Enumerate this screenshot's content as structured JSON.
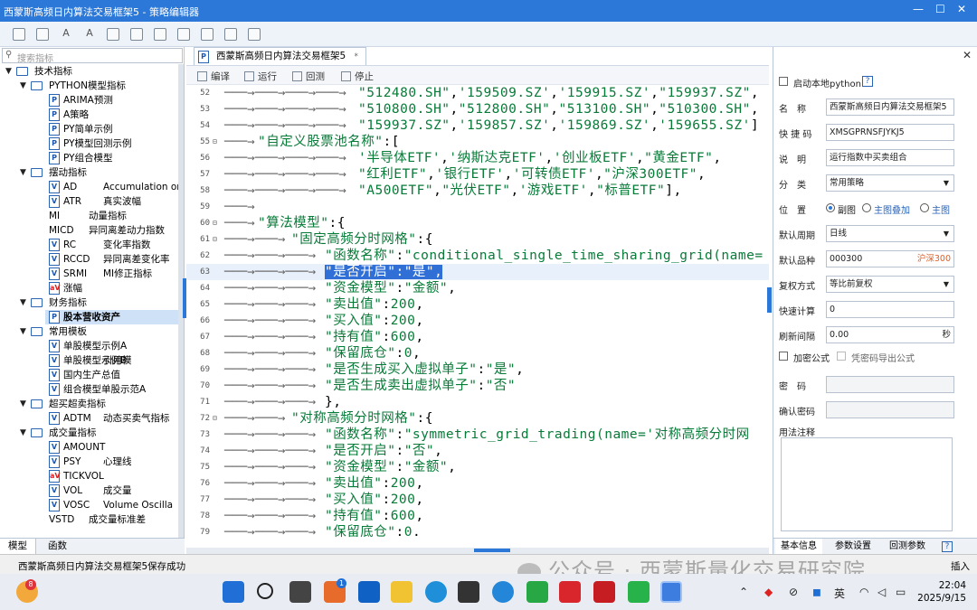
{
  "window": {
    "title": "西蒙斯高频日内算法交易框架5 - 策略编辑器"
  },
  "toolbar": {
    "icons": [
      "save-icon",
      "save-all-icon",
      "font-decrease-icon",
      "font-increase-icon",
      "import-icon",
      "export-icon",
      "copy-icon",
      "paste-icon",
      "doc-icon",
      "settings-icon",
      "doc-settings-icon"
    ]
  },
  "left": {
    "search_placeholder": "搜索指标",
    "tree": [
      {
        "level": 0,
        "kind": "folder",
        "expanded": true,
        "label": "技术指标"
      },
      {
        "level": 1,
        "kind": "folder",
        "expanded": true,
        "label": "PYTHON模型指标"
      },
      {
        "level": 2,
        "kind": "py",
        "label": "ARIMA预测"
      },
      {
        "level": 2,
        "kind": "py",
        "label": "A策略"
      },
      {
        "level": 2,
        "kind": "py",
        "label": "PY简单示例"
      },
      {
        "level": 2,
        "kind": "py",
        "label": "PY模型回测示例"
      },
      {
        "level": 2,
        "kind": "py",
        "label": "PY组合模型"
      },
      {
        "level": 1,
        "kind": "folder",
        "expanded": true,
        "label": "摆动指标"
      },
      {
        "level": 2,
        "kind": "v",
        "label": "AD",
        "desc": "Accumulation or"
      },
      {
        "level": 2,
        "kind": "v",
        "label": "ATR",
        "desc": "真实波幅"
      },
      {
        "level": 2,
        "kind": "none",
        "label": "MI",
        "desc": "动量指标"
      },
      {
        "level": 2,
        "kind": "none",
        "label": "MICD",
        "desc": "异同离差动力指数"
      },
      {
        "level": 2,
        "kind": "v",
        "label": "RC",
        "desc": "变化率指数"
      },
      {
        "level": 2,
        "kind": "v",
        "label": "RCCD",
        "desc": "异同离差变化率"
      },
      {
        "level": 2,
        "kind": "v",
        "label": "SRMI",
        "desc": "MI修正指标"
      },
      {
        "level": 2,
        "kind": "av",
        "label": "涨幅"
      },
      {
        "level": 1,
        "kind": "folder",
        "expanded": true,
        "label": "财务指标"
      },
      {
        "level": 2,
        "kind": "py",
        "label": "股本营收资产",
        "selected": true
      },
      {
        "level": 1,
        "kind": "folder",
        "expanded": true,
        "label": "常用模板"
      },
      {
        "level": 2,
        "kind": "v",
        "label": "单股模型示例A"
      },
      {
        "level": 2,
        "kind": "v",
        "label": "单股模型示例B",
        "desc": "引用模"
      },
      {
        "level": 2,
        "kind": "v",
        "label": "国内生产总值"
      },
      {
        "level": 2,
        "kind": "v",
        "label": "组合模型单股示范A"
      },
      {
        "level": 1,
        "kind": "folder",
        "expanded": true,
        "label": "超买超卖指标"
      },
      {
        "level": 2,
        "kind": "v",
        "label": "ADTM",
        "desc": "动态买卖气指标"
      },
      {
        "level": 1,
        "kind": "folder",
        "expanded": true,
        "label": "成交量指标"
      },
      {
        "level": 2,
        "kind": "v",
        "label": "AMOUNT"
      },
      {
        "level": 2,
        "kind": "v",
        "label": "PSY",
        "desc": "心理线"
      },
      {
        "level": 2,
        "kind": "av",
        "label": "TICKVOL"
      },
      {
        "level": 2,
        "kind": "v",
        "label": "VOL",
        "desc": "成交量"
      },
      {
        "level": 2,
        "kind": "v",
        "label": "VOSC",
        "desc": "Volume Oscilla"
      },
      {
        "level": 2,
        "kind": "none",
        "label": "VSTD",
        "desc": "成交量标准差"
      }
    ],
    "tabs": [
      "模型",
      "函数"
    ]
  },
  "editor": {
    "tab_label": "西蒙斯高频日内算法交易框架5",
    "tab_marker": "*",
    "buttons": {
      "compile": "编译",
      "run": "运行",
      "backtest": "回测",
      "stop": "停止"
    },
    "lines": [
      {
        "n": "52",
        "indent": 4,
        "fold": "",
        "segs": [
          [
            "s",
            "\"512480.SH\""
          ],
          [
            "k",
            ","
          ],
          [
            "s",
            "'159509.SZ'"
          ],
          [
            "k",
            ","
          ],
          [
            "s",
            "'159915.SZ'"
          ],
          [
            "k",
            ","
          ],
          [
            "s",
            "\"159937.SZ\""
          ],
          [
            "k",
            ","
          ]
        ]
      },
      {
        "n": "53",
        "indent": 4,
        "fold": "",
        "segs": [
          [
            "s",
            "\"510800.SH\""
          ],
          [
            "k",
            ","
          ],
          [
            "s",
            "\"512800.SH\""
          ],
          [
            "k",
            ","
          ],
          [
            "s",
            "\"513100.SH\""
          ],
          [
            "k",
            ","
          ],
          [
            "s",
            "\"510300.SH\""
          ],
          [
            "k",
            ","
          ]
        ]
      },
      {
        "n": "54",
        "indent": 4,
        "fold": "",
        "segs": [
          [
            "s",
            "\"159937.SZ\""
          ],
          [
            "k",
            ","
          ],
          [
            "s",
            "'159857.SZ'"
          ],
          [
            "k",
            ","
          ],
          [
            "s",
            "'159869.SZ'"
          ],
          [
            "k",
            ","
          ],
          [
            "s",
            "'159655.SZ'"
          ],
          [
            "k",
            "]"
          ]
        ]
      },
      {
        "n": "55",
        "indent": 1,
        "fold": "⊟",
        "segs": [
          [
            "s",
            "\"自定义股票池名称\""
          ],
          [
            "k",
            ":["
          ]
        ]
      },
      {
        "n": "56",
        "indent": 4,
        "fold": "",
        "segs": [
          [
            "s",
            "'半导体ETF'"
          ],
          [
            "k",
            ","
          ],
          [
            "s",
            "'纳斯达克ETF'"
          ],
          [
            "k",
            ","
          ],
          [
            "s",
            "'创业板ETF'"
          ],
          [
            "k",
            ","
          ],
          [
            "s",
            "\"黄金ETF\""
          ],
          [
            "k",
            ","
          ]
        ]
      },
      {
        "n": "57",
        "indent": 4,
        "fold": "",
        "segs": [
          [
            "s",
            "\"红利ETF\""
          ],
          [
            "k",
            ","
          ],
          [
            "s",
            "'银行ETF'"
          ],
          [
            "k",
            ","
          ],
          [
            "s",
            "'可转债ETF'"
          ],
          [
            "k",
            ","
          ],
          [
            "s",
            "\"沪深300ETF\""
          ],
          [
            "k",
            ","
          ]
        ]
      },
      {
        "n": "58",
        "indent": 4,
        "fold": "",
        "segs": [
          [
            "s",
            "\"A500ETF\""
          ],
          [
            "k",
            ","
          ],
          [
            "s",
            "\"光伏ETF\""
          ],
          [
            "k",
            ","
          ],
          [
            "s",
            "'游戏ETF'"
          ],
          [
            "k",
            ","
          ],
          [
            "s",
            "\"标普ETF\""
          ],
          [
            "k",
            "],"
          ]
        ]
      },
      {
        "n": "59",
        "indent": 1,
        "fold": "",
        "segs": []
      },
      {
        "n": "60",
        "indent": 1,
        "fold": "⊟",
        "segs": [
          [
            "s",
            "\"算法模型\""
          ],
          [
            "k",
            ":{"
          ]
        ]
      },
      {
        "n": "61",
        "indent": 2,
        "fold": "⊟",
        "segs": [
          [
            "s",
            "\"固定高频分时网格\""
          ],
          [
            "k",
            ":{"
          ]
        ]
      },
      {
        "n": "62",
        "indent": 3,
        "fold": "",
        "segs": [
          [
            "s",
            "\"函数名称\""
          ],
          [
            "k",
            ":"
          ],
          [
            "s",
            "\"conditional_single_time_sharing_grid(name="
          ]
        ]
      },
      {
        "n": "63",
        "indent": 3,
        "fold": "",
        "hl": true,
        "segs": [
          [
            "sel",
            "\"是否开启\":\"是\","
          ]
        ]
      },
      {
        "n": "64",
        "indent": 3,
        "fold": "",
        "segs": [
          [
            "s",
            "\"资金模型\""
          ],
          [
            "k",
            ":"
          ],
          [
            "s",
            "\"金额\""
          ],
          [
            "k",
            ","
          ]
        ]
      },
      {
        "n": "65",
        "indent": 3,
        "fold": "",
        "segs": [
          [
            "s",
            "\"卖出值\""
          ],
          [
            "k",
            ":"
          ],
          [
            "s",
            "200"
          ],
          [
            "k",
            ","
          ]
        ]
      },
      {
        "n": "66",
        "indent": 3,
        "fold": "",
        "segs": [
          [
            "s",
            "\"买入值\""
          ],
          [
            "k",
            ":"
          ],
          [
            "s",
            "200"
          ],
          [
            "k",
            ","
          ]
        ]
      },
      {
        "n": "67",
        "indent": 3,
        "fold": "",
        "segs": [
          [
            "s",
            "\"持有值\""
          ],
          [
            "k",
            ":"
          ],
          [
            "s",
            "600"
          ],
          [
            "k",
            ","
          ]
        ]
      },
      {
        "n": "68",
        "indent": 3,
        "fold": "",
        "segs": [
          [
            "s",
            "\"保留底仓\""
          ],
          [
            "k",
            ":"
          ],
          [
            "s",
            "0"
          ],
          [
            "k",
            ","
          ]
        ]
      },
      {
        "n": "69",
        "indent": 3,
        "fold": "",
        "segs": [
          [
            "s",
            "\"是否生成买入虚拟单子\""
          ],
          [
            "k",
            ":"
          ],
          [
            "s",
            "\"是\""
          ],
          [
            "k",
            ","
          ]
        ]
      },
      {
        "n": "70",
        "indent": 3,
        "fold": "",
        "segs": [
          [
            "s",
            "\"是否生成卖出虚拟单子\""
          ],
          [
            "k",
            ":"
          ],
          [
            "s",
            "\"否\""
          ]
        ]
      },
      {
        "n": "71",
        "indent": 3,
        "fold": "",
        "segs": [
          [
            "k",
            "},"
          ]
        ]
      },
      {
        "n": "72",
        "indent": 2,
        "fold": "⊟",
        "segs": [
          [
            "s",
            "\"对称高频分时网格\""
          ],
          [
            "k",
            ":{"
          ]
        ]
      },
      {
        "n": "73",
        "indent": 3,
        "fold": "",
        "segs": [
          [
            "s",
            "\"函数名称\""
          ],
          [
            "k",
            ":"
          ],
          [
            "s",
            "\"symmetric_grid_trading(name='对称高频分时网"
          ]
        ]
      },
      {
        "n": "74",
        "indent": 3,
        "fold": "",
        "segs": [
          [
            "s",
            "\"是否开启\""
          ],
          [
            "k",
            ":"
          ],
          [
            "s",
            "\"否\""
          ],
          [
            "k",
            ","
          ]
        ]
      },
      {
        "n": "75",
        "indent": 3,
        "fold": "",
        "segs": [
          [
            "s",
            "\"资金模型\""
          ],
          [
            "k",
            ":"
          ],
          [
            "s",
            "\"金额\""
          ],
          [
            "k",
            ","
          ]
        ]
      },
      {
        "n": "76",
        "indent": 3,
        "fold": "",
        "segs": [
          [
            "s",
            "\"卖出值\""
          ],
          [
            "k",
            ":"
          ],
          [
            "s",
            "200"
          ],
          [
            "k",
            ","
          ]
        ]
      },
      {
        "n": "77",
        "indent": 3,
        "fold": "",
        "segs": [
          [
            "s",
            "\"买入值\""
          ],
          [
            "k",
            ":"
          ],
          [
            "s",
            "200"
          ],
          [
            "k",
            ","
          ]
        ]
      },
      {
        "n": "78",
        "indent": 3,
        "fold": "",
        "segs": [
          [
            "s",
            "\"持有值\""
          ],
          [
            "k",
            ":"
          ],
          [
            "s",
            "600"
          ],
          [
            "k",
            ","
          ]
        ]
      },
      {
        "n": "79",
        "indent": 3,
        "fold": "",
        "segs": [
          [
            "s",
            "\"保留底仓\""
          ],
          [
            "k",
            ":"
          ],
          [
            "s",
            "0"
          ],
          [
            "k",
            "."
          ]
        ]
      }
    ]
  },
  "props": {
    "enable_local_python": "启动本地python",
    "name_label": "名　称",
    "name_value": "西蒙斯高频日内算法交易框架5",
    "code_label": "快 捷 码",
    "code_value": "XMSGPRNSFJYKJ5",
    "desc_label": "说　明",
    "desc_value": "运行指数中买卖组合",
    "cat_label": "分　类",
    "cat_value": "常用策略",
    "pos_label": "位　置",
    "pos_opts": [
      "副图",
      "主图叠加",
      "主图"
    ],
    "period_label": "默认周期",
    "period_value": "日线",
    "symbol_label": "默认品种",
    "symbol_value": "000300",
    "symbol_name": "沪深300",
    "adjust_label": "复权方式",
    "adjust_value": "等比前复权",
    "quick_label": "快速计算",
    "quick_value": "0",
    "refresh_label": "刷新间隔",
    "refresh_value": "0.00",
    "refresh_unit": "秒",
    "encrypt_label": "加密公式",
    "encrypt_export": "凭密码导出公式",
    "pwd_label": "密　码",
    "confirm_label": "确认密码",
    "notes_label": "用法注释",
    "tabs": [
      "基本信息",
      "参数设置",
      "回测参数"
    ],
    "help": "?"
  },
  "status": {
    "message": "西蒙斯高频日内算法交易框架5保存成功",
    "mode": "插入"
  },
  "watermark": "公众号 · 西蒙斯量化交易研究院",
  "taskbar": {
    "badge_left": "8",
    "badge_store": "1",
    "ime": "英",
    "time": "22:04",
    "date": "2025/9/15"
  },
  "colors": {
    "titlebar": "#2b78d8",
    "selection": "#2f6fd6",
    "string": "#087a38"
  }
}
